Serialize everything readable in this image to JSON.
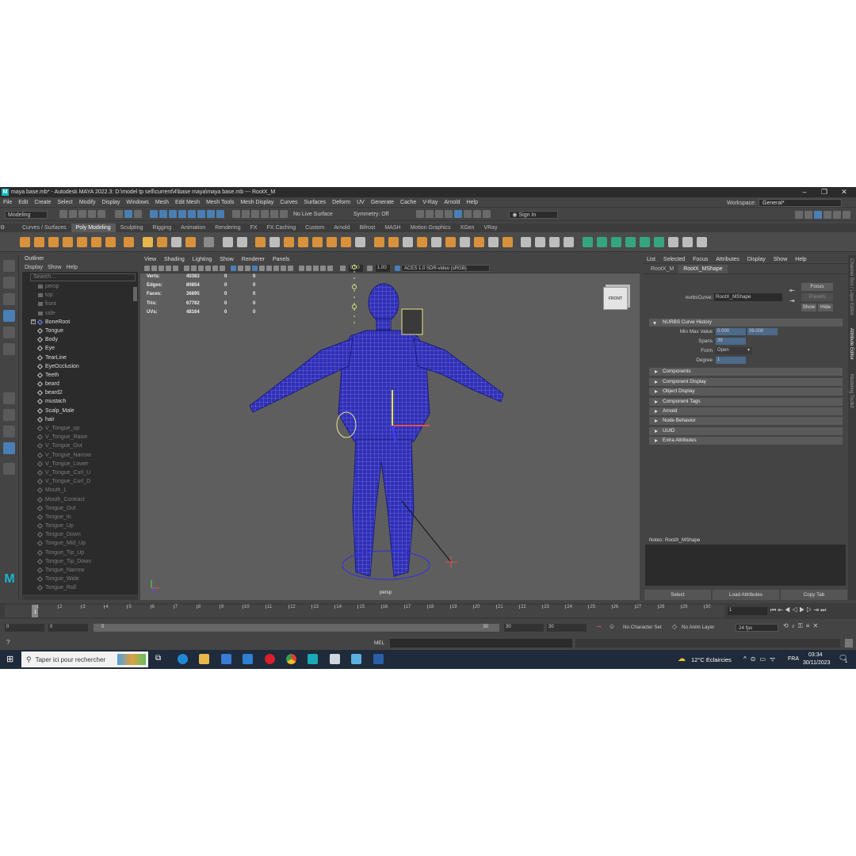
{
  "titlebar": {
    "text": "maya base.mb* - Autodesk MAYA 2022.3: D:\\model tp sell\\current\\4\\base maya\\maya base.mb  ---  RootX_M",
    "logo": "M"
  },
  "menubar": {
    "items": [
      "File",
      "Edit",
      "Create",
      "Select",
      "Modify",
      "Display",
      "Windows",
      "Mesh",
      "Edit Mesh",
      "Mesh Tools",
      "Mesh Display",
      "Curves",
      "Surfaces",
      "Deform",
      "UV",
      "Generate",
      "Cache",
      "V-Ray",
      "Arnold",
      "Help"
    ],
    "workspace_label": "Workspace:",
    "workspace_value": "General*"
  },
  "statusline": {
    "mode": "Modeling",
    "live_surface": "No Live Surface",
    "symmetry": "Symmetry: Off",
    "sign_in": "Sign In"
  },
  "shelf": {
    "tabs": [
      "Curves / Surfaces",
      "Poly Modeling",
      "Sculpting",
      "Rigging",
      "Animation",
      "Rendering",
      "FX",
      "FX Caching",
      "Custom",
      "Arnold",
      "Bifrost",
      "MASH",
      "Motion Graphics",
      "XGen",
      "VRay"
    ],
    "active_tab": "Poly Modeling"
  },
  "outliner": {
    "title": "Outliner",
    "menu": [
      "Display",
      "Show",
      "Help"
    ],
    "search_placeholder": "Search...",
    "cameras": [
      "persp",
      "top",
      "front",
      "side"
    ],
    "items": [
      "BoneRoot",
      "Tongue",
      "Body",
      "Eye",
      "TearLine",
      "EyeOcclusion",
      "Teeth",
      "beard",
      "beard2",
      "mustach",
      "Scalp_Male",
      "hair"
    ],
    "dim_items": [
      "V_Tongue_up",
      "V_Tongue_Raise",
      "V_Tongue_Out",
      "V_Tongue_Narrow",
      "V_Tongue_Lower",
      "V_Tongue_Curl_U",
      "V_Tongue_Curl_D",
      "Mouth_L",
      "Mouth_Contract",
      "Tongue_Out",
      "Tongue_In",
      "Tongue_Up",
      "Tongue_Down",
      "Tongue_Mid_Up",
      "Tongue_Tip_Up",
      "Tongue_Tip_Down",
      "Tongue_Narrow",
      "Tongue_Wide",
      "Tongue_Roll"
    ]
  },
  "viewport": {
    "menu": [
      "View",
      "Shading",
      "Lighting",
      "Show",
      "Renderer",
      "Panels"
    ],
    "exposure": "0.00",
    "gamma": "1.00",
    "color_space": "ACES 1.0 SDR-video (sRGB)",
    "hud": [
      {
        "label": "Verts:",
        "v1": "40383",
        "v2": "0",
        "v3": "0"
      },
      {
        "label": "Edges:",
        "v1": "80854",
        "v2": "0",
        "v3": "0"
      },
      {
        "label": "Faces:",
        "v1": "36895",
        "v2": "0",
        "v3": "0"
      },
      {
        "label": "Tris:",
        "v1": "67782",
        "v2": "0",
        "v3": "0"
      },
      {
        "label": "UVs:",
        "v1": "48164",
        "v2": "0",
        "v3": "0"
      }
    ],
    "view_cube": "FRONT",
    "camera": "persp"
  },
  "attribute_editor": {
    "menu": [
      "List",
      "Selected",
      "Focus",
      "Attributes",
      "Display",
      "Show",
      "Help"
    ],
    "tabs": [
      "RootX_M",
      "RootX_MShape"
    ],
    "active_tab": "RootX_MShape",
    "node_label": "nurbsCurve:",
    "node_value": "RootX_MShape",
    "focus_btn": "Focus",
    "presets_btn": "Presets",
    "show_btn": "Show",
    "hide_btn": "Hide",
    "history_section": "NURBS Curve History",
    "min_max_label": "Min Max Value",
    "min_value": "0.000",
    "max_value": "39.000",
    "spans_label": "Spans",
    "spans_value": "39",
    "form_label": "Form",
    "form_value": "Open",
    "degree_label": "Degree",
    "degree_value": "1",
    "sections": [
      "Components",
      "Component Display",
      "Object Display",
      "Component Tags",
      "Arnold",
      "Node Behavior",
      "UUID",
      "Extra Attributes"
    ],
    "notes": "Notes:  RootX_MShape",
    "bottom_buttons": [
      "Select",
      "Load Attributes",
      "Copy Tab"
    ],
    "side_tabs": [
      "Channel Box / Layer Editor",
      "Attribute Editor",
      "Modeling Toolkit"
    ]
  },
  "timeline": {
    "ticks": [
      "1",
      "2",
      "3",
      "4",
      "5",
      "6",
      "7",
      "8",
      "9",
      "10",
      "11",
      "12",
      "13",
      "14",
      "15",
      "16",
      "17",
      "18",
      "19",
      "20",
      "21",
      "22",
      "23",
      "24",
      "25",
      "26",
      "27",
      "28",
      "29",
      "30"
    ],
    "current_frame": "1",
    "range_start": "0",
    "range_start2": "0",
    "range_slider_start": "0",
    "range_slider_end": "30",
    "range_end": "30",
    "range_end2": "30",
    "character_set": "No Character Set",
    "anim_layer": "No Anim Layer",
    "fps": "24 fps"
  },
  "cmdline": {
    "label": "MEL",
    "help": "?"
  },
  "taskbar": {
    "search_placeholder": "Taper ici pour rechercher",
    "weather": "12°C  Eclaircies",
    "language": "FRA",
    "time": "03:34",
    "date": "30/11/2023",
    "notification_count": "1"
  },
  "colors": {
    "maya_bg": "#444444",
    "viewport_bg": "#5e5e5e",
    "mesh": "#2b2ba8",
    "accent_blue": "#4a7fb5",
    "shelf_orange": "#d9923b",
    "shelf_green": "#35a580"
  }
}
